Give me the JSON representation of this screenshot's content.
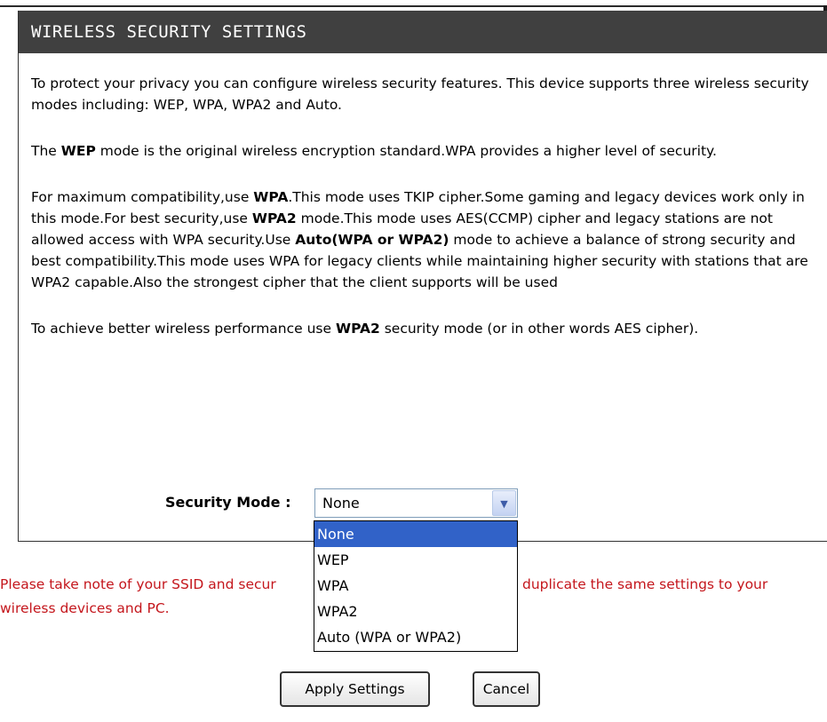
{
  "section": {
    "title": "WIRELESS SECURITY SETTINGS"
  },
  "intro": {
    "p1": "To protect your privacy you can configure wireless security features. This device supports three wireless security modes including: WEP, WPA, WPA2 and Auto.",
    "p2_bold": "WEP",
    "p2_rest": " mode is the original wireless encryption standard.WPA provides a higher level of security.",
    "p2_prefix": "The ",
    "p3_a": "For maximum compatibility,use ",
    "p3_b": "WPA",
    "p3_c": ".This mode uses TKIP cipher.Some gaming and legacy devices work only in this mode.For best security,use ",
    "p3_d": "WPA2",
    "p3_e": " mode.This mode uses AES(CCMP) cipher and legacy stations are not allowed access with WPA security.Use ",
    "p3_f": "Auto(WPA or WPA2)",
    "p3_g": " mode to achieve a balance of strong security and best compatibility.This mode uses WPA for legacy clients while maintaining higher security with stations that are WPA2 capable.Also the strongest cipher that the client supports will be used",
    "p4_a": "To achieve better wireless performance use ",
    "p4_b": "WPA2",
    "p4_c": " security mode (or in other words AES cipher)."
  },
  "security_mode": {
    "label": "Security Mode :",
    "value": "None",
    "options": [
      "None",
      "WEP",
      "WPA",
      "WPA2",
      "Auto (WPA or WPA2)"
    ]
  },
  "note": {
    "line1_left": "Please take note of your SSID and secur",
    "line1_right": "duplicate the same settings to your",
    "line2": "wireless devices and PC."
  },
  "buttons": {
    "apply": "Apply Settings",
    "cancel": "Cancel"
  },
  "colors": {
    "header_bg": "#404040",
    "note_text": "#c4161c",
    "selected_option_bg": "#3162c8"
  }
}
